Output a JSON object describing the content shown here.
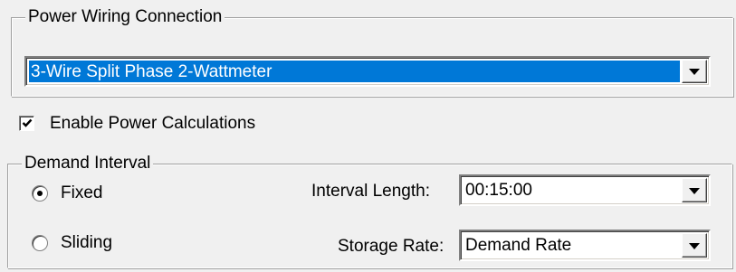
{
  "power_wiring": {
    "title": "Power Wiring Connection",
    "selected_value": "3-Wire Split Phase 2-Wattmeter"
  },
  "power_calculations": {
    "label": "Enable Power Calculations",
    "checked": true
  },
  "demand_interval": {
    "title": "Demand Interval",
    "options": [
      {
        "label": "Fixed",
        "selected": true
      },
      {
        "label": "Sliding",
        "selected": false
      }
    ],
    "interval_length": {
      "label": "Interval Length:",
      "value": "00:15:00"
    },
    "storage_rate": {
      "label": "Storage Rate:",
      "value": "Demand Rate"
    }
  },
  "icons": {
    "dropdown": "chevron-down-icon",
    "check": "check-icon",
    "radio_dot": "radio-dot-icon"
  },
  "colors": {
    "selection_highlight": "#0078d7",
    "window_background": "#f0f0f0"
  }
}
